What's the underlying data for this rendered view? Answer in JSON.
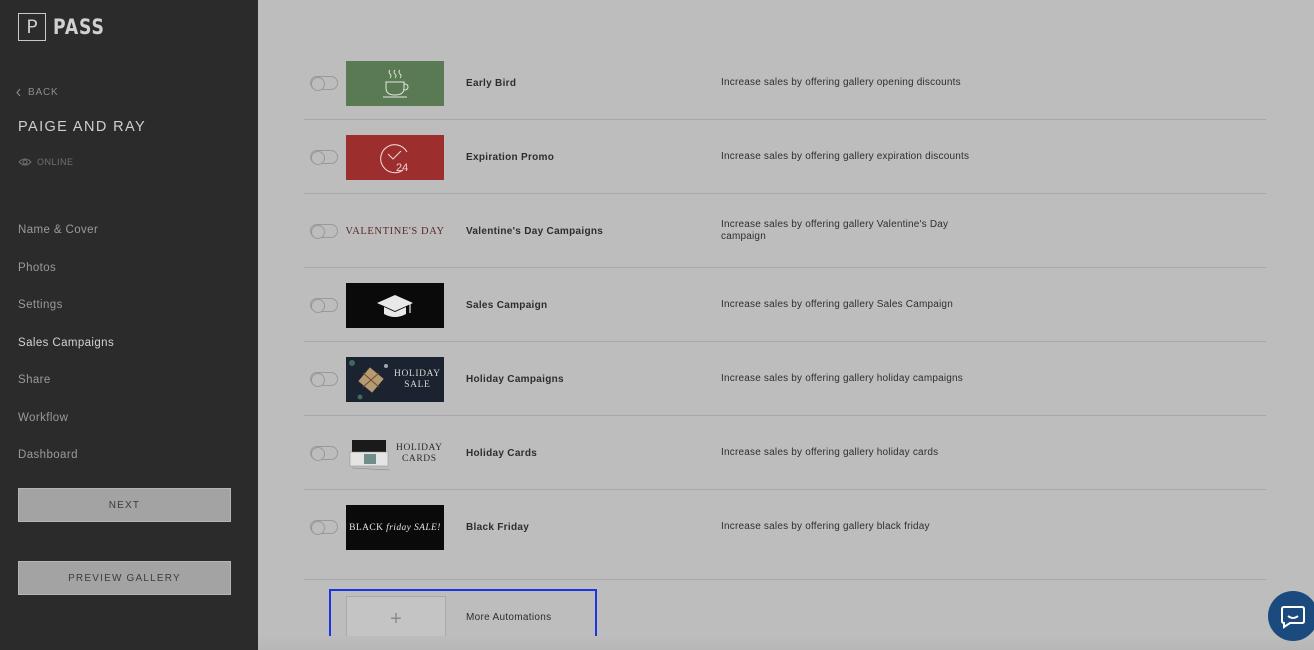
{
  "brand": {
    "logo_letter": "P",
    "name": "PASS"
  },
  "sidebar": {
    "back_label": "BACK",
    "gallery_name": "PAIGE AND RAY",
    "status": "ONLINE",
    "items": [
      {
        "label": "Name & Cover"
      },
      {
        "label": "Photos"
      },
      {
        "label": "Settings"
      },
      {
        "label": "Sales Campaigns",
        "active": true
      },
      {
        "label": "Share"
      },
      {
        "label": "Workflow"
      },
      {
        "label": "Dashboard"
      }
    ],
    "next_label": "NEXT",
    "preview_label": "PREVIEW GALLERY"
  },
  "campaigns": [
    {
      "title": "Early Bird",
      "description": "Increase sales by offering gallery opening discounts",
      "thumb": "coffee-cup-icon",
      "thumb_color": "#5a7a54",
      "enabled": false
    },
    {
      "title": "Expiration Promo",
      "description": "Increase sales by offering gallery expiration discounts",
      "thumb": "clock-24-icon",
      "thumb_color": "#9c2e2e",
      "thumb_text": "24",
      "enabled": false
    },
    {
      "title": "Valentine's Day Campaigns",
      "description": "Increase sales by offering gallery Valentine's Day campaign",
      "thumb": "valentines-text",
      "thumb_text": "VALENTINE'S DAY",
      "enabled": false
    },
    {
      "title": "Sales Campaign",
      "description": "Increase sales by offering gallery Sales Campaign",
      "thumb": "graduation-cap-icon",
      "thumb_color": "#0a0a0a",
      "enabled": false
    },
    {
      "title": "Holiday Campaigns",
      "description": "Increase sales by offering gallery holiday campaigns",
      "thumb": "holiday-sale-image",
      "thumb_color": "#1b2230",
      "thumb_text_1": "HOLIDAY",
      "thumb_text_2": "SALE",
      "enabled": false
    },
    {
      "title": "Holiday Cards",
      "description": "Increase sales by offering gallery holiday cards",
      "thumb": "holiday-cards-image",
      "thumb_text_1": "HOLIDAY",
      "thumb_text_2": "CARDS",
      "enabled": false
    },
    {
      "title": "Black Friday",
      "description": "Increase sales by offering gallery black friday",
      "thumb": "black-friday-image",
      "thumb_color": "#0a0a0a",
      "thumb_text": "BLACK",
      "thumb_text_italic": "friday SALE!",
      "enabled": false
    }
  ],
  "more": {
    "icon": "+",
    "label": "More Automations"
  },
  "colors": {
    "sidebar_bg": "#2b2b2b",
    "main_bg": "#bdbdbd",
    "highlight": "#1a36e0",
    "chat": "#1a4a7e"
  }
}
